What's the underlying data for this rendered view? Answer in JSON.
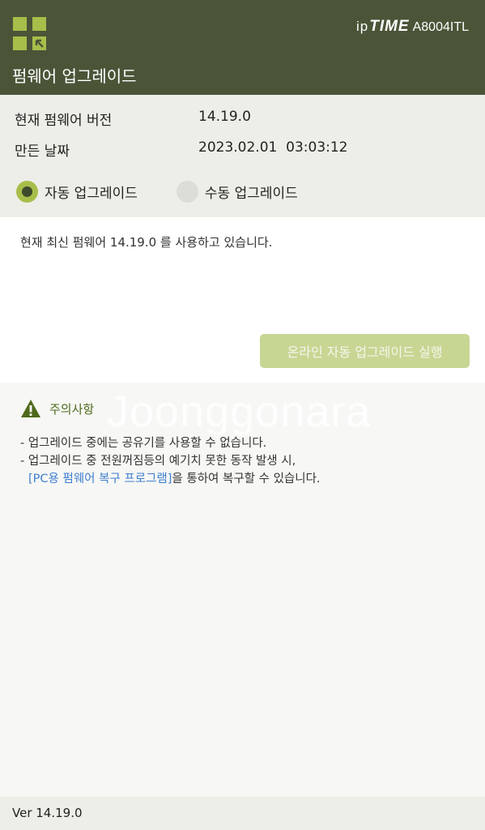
{
  "header": {
    "title": "펌웨어 업그레이드",
    "brand_ip": "ip",
    "brand_time": "TIME",
    "model": "A8004ITL",
    "logo_icon": "iptime-logo-icon"
  },
  "firmware": {
    "current_label": "현재 펌웨어 버전",
    "current_value": "14.19.0",
    "date_label": "만든 날짜",
    "date_value": "2023.02.01  03:03:12"
  },
  "mode": {
    "options": [
      {
        "label": "자동 업그레이드",
        "selected": true
      },
      {
        "label": "수동 업그레이드",
        "selected": false
      }
    ]
  },
  "status": {
    "message": "현재 최신 펌웨어 14.19.0 를 사용하고 있습니다.",
    "run_button": "온라인 자동 업그레이드 실행",
    "run_enabled": false
  },
  "caution": {
    "title": "주의사항",
    "watermark": "Joonggonara",
    "note1": "- 업그레이드 중에는 공유기를 사용할 수 없습니다.",
    "note2": "- 업그레이드 중 전원꺼짐등의 예기치 못한 동작 발생 시,",
    "note3_link": "[PC용 펌웨어 복구 프로그램]",
    "note3_rest": "을 통하여 복구할 수 있습니다."
  },
  "footer": {
    "version": "Ver 14.19.0"
  },
  "colors": {
    "header_bg": "#4a5538",
    "accent": "#a7be4a",
    "button_disabled": "#c8d694",
    "link": "#3f7fd0",
    "caution_green": "#4f6a1c"
  }
}
